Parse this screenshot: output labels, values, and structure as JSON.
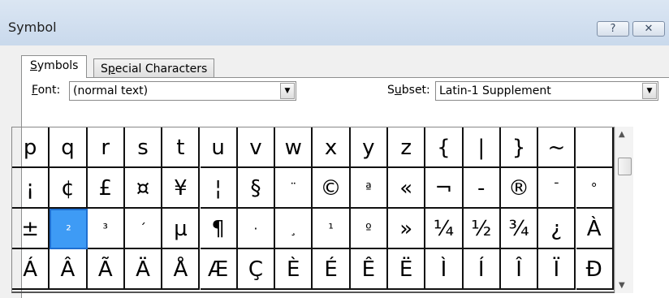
{
  "window": {
    "title": "Symbol",
    "help_glyph": "?",
    "close_glyph": "✕"
  },
  "tabs": [
    {
      "pre": "",
      "accel": "S",
      "post": "ymbols"
    },
    {
      "pre": "S",
      "accel": "p",
      "post": "ecial Characters"
    }
  ],
  "font": {
    "pre": "",
    "accel": "F",
    "post": "ont:",
    "value": "(normal text)"
  },
  "subset": {
    "pre": "S",
    "accel": "u",
    "post": "bset:",
    "value": "Latin-1 Supplement"
  },
  "combo_arrow": "▼",
  "scroll": {
    "up": "▲",
    "down": "▼"
  },
  "selected_index": 33,
  "grid": [
    [
      "p",
      "q",
      "r",
      "s",
      "t",
      "u",
      "v",
      "w",
      "x",
      "y",
      "z",
      "{",
      "|",
      "}",
      "~",
      ""
    ],
    [
      "¡",
      "¢",
      "£",
      "¤",
      "¥",
      "¦",
      "§",
      "¨",
      "©",
      "ª",
      "«",
      "¬",
      "-",
      "®",
      "¯",
      "°"
    ],
    [
      "±",
      "²",
      "³",
      "´",
      "µ",
      "¶",
      "·",
      "¸",
      "¹",
      "º",
      "»",
      "¼",
      "½",
      "¾",
      "¿",
      "À"
    ],
    [
      "Á",
      "Â",
      "Ã",
      "Ä",
      "Å",
      "Æ",
      "Ç",
      "È",
      "É",
      "Ê",
      "Ë",
      "Ì",
      "Í",
      "Î",
      "Ï",
      "Ð"
    ]
  ]
}
